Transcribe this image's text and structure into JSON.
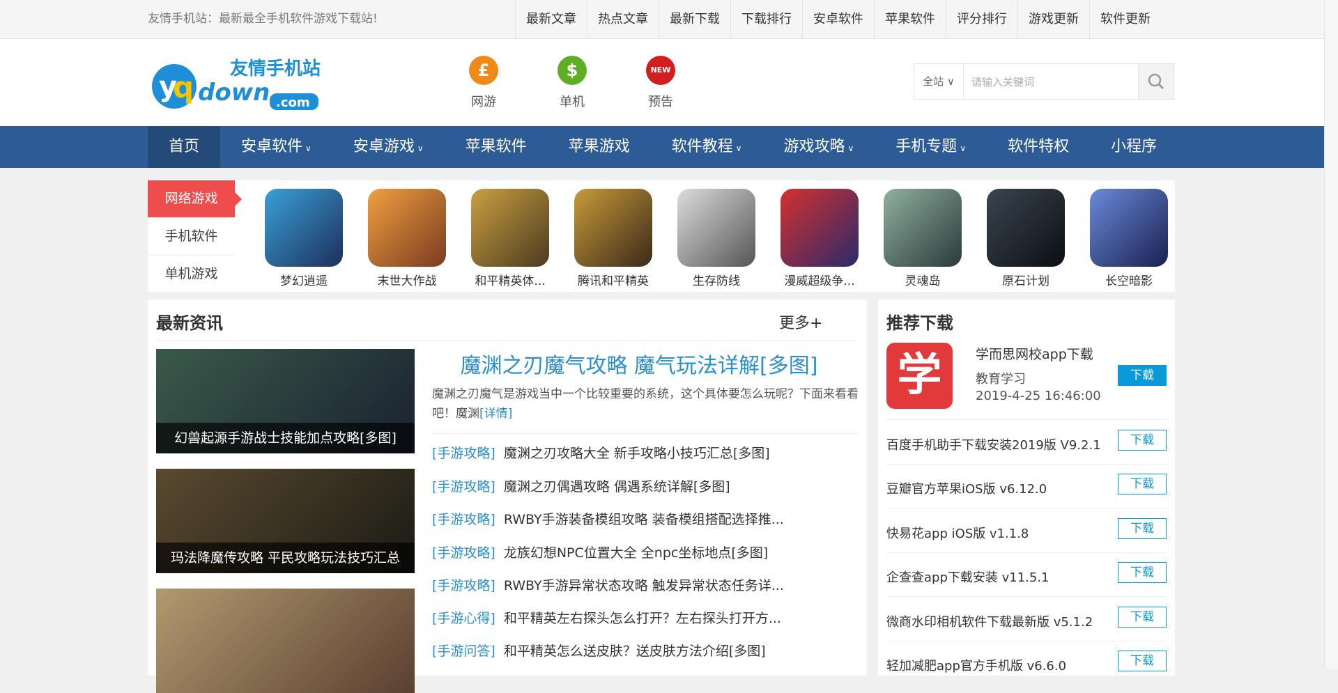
{
  "topbar": {
    "slogan": "友情手机站：最新最全手机软件游戏下载站!",
    "links": [
      "最新文章",
      "热点文章",
      "最新下载",
      "下载排行",
      "安卓软件",
      "苹果软件",
      "评分排行",
      "游戏更新",
      "软件更新"
    ]
  },
  "header": {
    "logo_text": "友情手机站",
    "icons": [
      {
        "label": "网游",
        "symbol": "£",
        "color": "#f08a17",
        "icon": "pound-coin-icon"
      },
      {
        "label": "单机",
        "symbol": "$",
        "color": "#5fae26",
        "icon": "dollar-coin-icon"
      },
      {
        "label": "预告",
        "symbol": "NEW",
        "color": "#d11f1f",
        "icon": "new-badge-icon"
      }
    ],
    "search": {
      "scope": "全站 ∨",
      "placeholder": "请输入关键词",
      "value": ""
    }
  },
  "nav": [
    {
      "label": "首页",
      "caret": ""
    },
    {
      "label": "安卓软件",
      "caret": "∨"
    },
    {
      "label": "安卓游戏",
      "caret": "∨"
    },
    {
      "label": "苹果软件",
      "caret": ""
    },
    {
      "label": "苹果游戏",
      "caret": ""
    },
    {
      "label": "软件教程",
      "caret": "∨"
    },
    {
      "label": "游戏攻略",
      "caret": "∨"
    },
    {
      "label": "手机专题",
      "caret": "∨"
    },
    {
      "label": "软件特权",
      "caret": ""
    },
    {
      "label": "小程序",
      "caret": ""
    }
  ],
  "games": {
    "tabs": [
      "网络游戏",
      "手机软件",
      "单机游戏"
    ],
    "items": [
      {
        "name": "梦幻逍遥",
        "c1": "#3aa0d8",
        "c2": "#1d2f5a"
      },
      {
        "name": "末世大作战",
        "c1": "#f0a040",
        "c2": "#7a3a20"
      },
      {
        "name": "和平精英体...",
        "c1": "#caa040",
        "c2": "#4a3a20"
      },
      {
        "name": "腾讯和平精英",
        "c1": "#c89a3a",
        "c2": "#3a2a1a"
      },
      {
        "name": "生存防线",
        "c1": "#dddddd",
        "c2": "#555555"
      },
      {
        "name": "漫威超级争...",
        "c1": "#d43030",
        "c2": "#2a2a6a"
      },
      {
        "name": "灵魂岛",
        "c1": "#8fb0a0",
        "c2": "#2a3a3a"
      },
      {
        "name": "原石计划",
        "c1": "#3a4550",
        "c2": "#0a0f14"
      },
      {
        "name": "长空暗影",
        "c1": "#6a8ad8",
        "c2": "#1a2050"
      }
    ]
  },
  "news": {
    "title": "最新资讯",
    "more": "更多+",
    "thumbs": [
      {
        "caption": "幻兽起源手游战士技能加点攻略[多图]",
        "c1": "#3a5a4a",
        "c2": "#1a2030"
      },
      {
        "caption": "玛法降魔传攻略 平民攻略玩法技巧汇总",
        "c1": "#5a4a30",
        "c2": "#1a1a14"
      },
      {
        "caption": "",
        "c1": "#b09a70",
        "c2": "#5a4030"
      }
    ],
    "headline": "魔渊之刃魔气攻略 魔气玩法详解[多图]",
    "summary": "魔渊之刃魔气是游戏当中一个比较重要的系统，这个具体要怎么玩呢？下面来看看吧！魔渊",
    "detail": "[详情]",
    "list": [
      {
        "cat": "[手游攻略]",
        "title": "魔渊之刃攻略大全 新手攻略小技巧汇总[多图]"
      },
      {
        "cat": "[手游攻略]",
        "title": "魔渊之刃偶遇攻略 偶遇系统详解[多图]"
      },
      {
        "cat": "[手游攻略]",
        "title": "RWBY手游装备模组攻略 装备模组搭配选择推..."
      },
      {
        "cat": "[手游攻略]",
        "title": "龙族幻想NPC位置大全 全npc坐标地点[多图]"
      },
      {
        "cat": "[手游攻略]",
        "title": "RWBY手游异常状态攻略 触发异常状态任务详..."
      },
      {
        "cat": "[手游心得]",
        "title": "和平精英左右探头怎么打开？左右探头打开方..."
      },
      {
        "cat": "[手游问答]",
        "title": "和平精英怎么送皮肤？送皮肤方法介绍[多图]"
      }
    ]
  },
  "recommend": {
    "title": "推荐下载",
    "featured": {
      "icon_char": "学",
      "name": "学而思网校app下载安",
      "category": "教育学习",
      "date": "2019-4-25 16:46:00",
      "button": "下载"
    },
    "items": [
      {
        "name": "百度手机助手下载安装2019版 V9.2.1",
        "button": "下载"
      },
      {
        "name": "豆瓣官方苹果iOS版 v6.12.0",
        "button": "下载"
      },
      {
        "name": "快易花app iOS版 v1.1.8",
        "button": "下载"
      },
      {
        "name": "企查查app下载安装 v11.5.1",
        "button": "下载"
      },
      {
        "name": "微商水印相机软件下载最新版 v5.1.2",
        "button": "下载"
      },
      {
        "name": "轻加减肥app官方手机版 v6.6.0",
        "button": "下载"
      }
    ]
  }
}
